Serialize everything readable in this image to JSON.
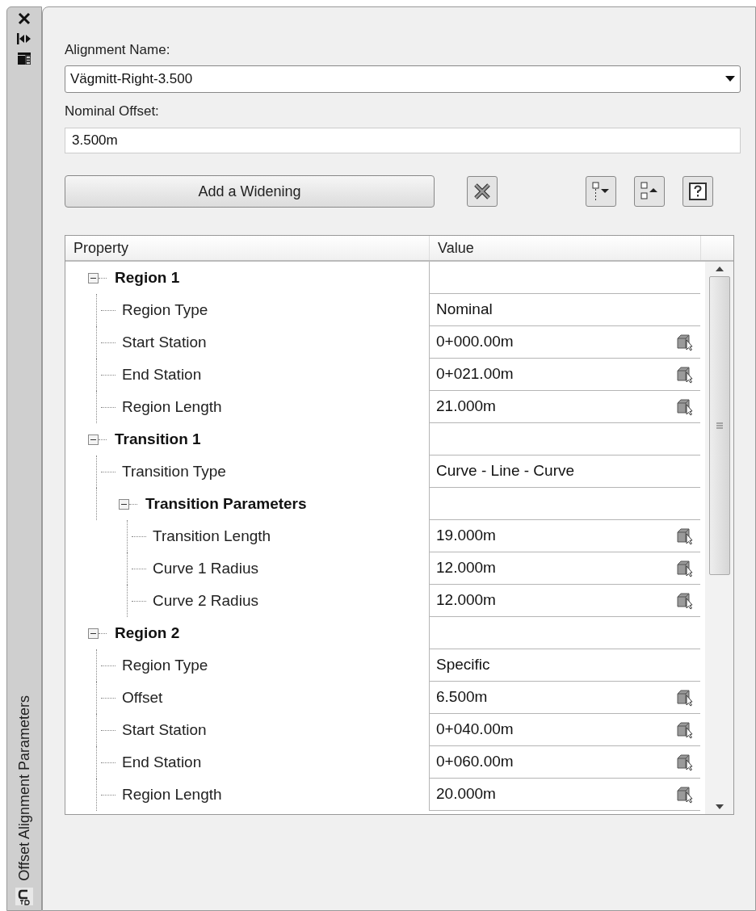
{
  "sidebar": {
    "title": "Offset Alignment Parameters"
  },
  "alignment": {
    "label": "Alignment Name:",
    "value": "Vägmitt-Right-3.500"
  },
  "nominal_offset": {
    "label": "Nominal Offset:",
    "value": "3.500m"
  },
  "add_button": "Add a Widening",
  "table": {
    "columns": [
      "Property",
      "Value"
    ],
    "rows": [
      {
        "label": "Region 1",
        "expanded": true,
        "children": [
          {
            "label": "Region Type",
            "value": "Nominal",
            "pickable": false
          },
          {
            "label": "Start Station",
            "value": "0+000.00m",
            "pickable": true
          },
          {
            "label": "End Station",
            "value": "0+021.00m",
            "pickable": true
          },
          {
            "label": "Region Length",
            "value": "21.000m",
            "pickable": true
          }
        ]
      },
      {
        "label": "Transition 1",
        "expanded": true,
        "children": [
          {
            "label": "Transition Type",
            "value": "Curve - Line - Curve",
            "pickable": false
          },
          {
            "label": "Transition Parameters",
            "expanded": true,
            "children": [
              {
                "label": "Transition Length",
                "value": "19.000m",
                "pickable": true
              },
              {
                "label": "Curve 1 Radius",
                "value": "12.000m",
                "pickable": true
              },
              {
                "label": "Curve 2 Radius",
                "value": "12.000m",
                "pickable": true
              }
            ]
          }
        ]
      },
      {
        "label": "Region 2",
        "expanded": true,
        "children": [
          {
            "label": "Region Type",
            "value": "Specific",
            "pickable": false
          },
          {
            "label": "Offset",
            "value": "6.500m",
            "pickable": true
          },
          {
            "label": "Start Station",
            "value": "0+040.00m",
            "pickable": true
          },
          {
            "label": "End Station",
            "value": "0+060.00m",
            "pickable": true
          },
          {
            "label": "Region Length",
            "value": "20.000m",
            "pickable": true
          }
        ]
      }
    ]
  }
}
